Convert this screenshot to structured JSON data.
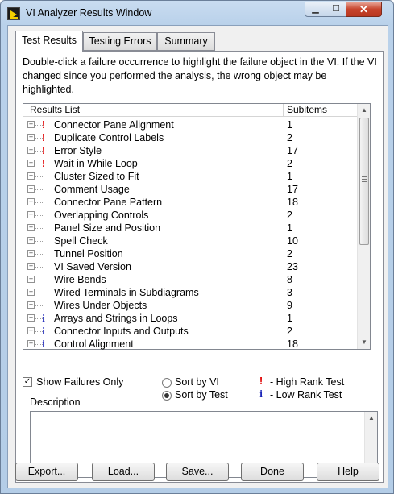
{
  "window": {
    "title": "VI Analyzer Results Window",
    "minimize_glyph": "▁",
    "maximize_glyph": "☐",
    "close_glyph": "✕"
  },
  "tabs": [
    {
      "label": "Test Results",
      "active": true
    },
    {
      "label": "Testing Errors",
      "active": false
    },
    {
      "label": "Summary",
      "active": false
    }
  ],
  "instructions": "Double-click a failure occurrence to highlight the failure object in the VI.  If the VI changed since you performed the analysis, the wrong object may be highlighted.",
  "results": {
    "col_name": "Results List",
    "col_count": "Subitems",
    "expand_glyph": "+",
    "scroll_up": "▲",
    "scroll_down": "▼",
    "rows": [
      {
        "mark": "!",
        "rank": "high",
        "name": "Connector Pane Alignment",
        "count": "1"
      },
      {
        "mark": "!",
        "rank": "high",
        "name": "Duplicate Control Labels",
        "count": "2"
      },
      {
        "mark": "!",
        "rank": "high",
        "name": "Error Style",
        "count": "17"
      },
      {
        "mark": "!",
        "rank": "high",
        "name": "Wait in While Loop",
        "count": "2"
      },
      {
        "mark": "",
        "rank": "none",
        "name": "Cluster Sized to Fit",
        "count": "1"
      },
      {
        "mark": "",
        "rank": "none",
        "name": "Comment Usage",
        "count": "17"
      },
      {
        "mark": "",
        "rank": "none",
        "name": "Connector Pane Pattern",
        "count": "18"
      },
      {
        "mark": "",
        "rank": "none",
        "name": "Overlapping Controls",
        "count": "2"
      },
      {
        "mark": "",
        "rank": "none",
        "name": "Panel Size and Position",
        "count": "1"
      },
      {
        "mark": "",
        "rank": "none",
        "name": "Spell Check",
        "count": "10"
      },
      {
        "mark": "",
        "rank": "none",
        "name": "Tunnel Position",
        "count": "2"
      },
      {
        "mark": "",
        "rank": "none",
        "name": "VI Saved Version",
        "count": "23"
      },
      {
        "mark": "",
        "rank": "none",
        "name": "Wire Bends",
        "count": "8"
      },
      {
        "mark": "",
        "rank": "none",
        "name": "Wired Terminals in Subdiagrams",
        "count": "3"
      },
      {
        "mark": "",
        "rank": "none",
        "name": "Wires Under Objects",
        "count": "9"
      },
      {
        "mark": "i",
        "rank": "low",
        "name": "Arrays and Strings in Loops",
        "count": "1"
      },
      {
        "mark": "i",
        "rank": "low",
        "name": "Connector Inputs and Outputs",
        "count": "2"
      },
      {
        "mark": "i",
        "rank": "low",
        "name": "Control Alignment",
        "count": "18"
      }
    ]
  },
  "options": {
    "show_failures_label": "Show Failures Only",
    "show_failures_checked": true,
    "check_glyph": "✓",
    "sort_by_vi_label": "Sort by VI",
    "sort_by_test_label": "Sort by Test",
    "sort_selected": "Sort by Test"
  },
  "legend": {
    "high_mark": "!",
    "high_label": "- High Rank Test",
    "low_mark": "i",
    "low_label": "- Low Rank Test"
  },
  "description": {
    "label": "Description",
    "text": ""
  },
  "buttons": {
    "export": "Export...",
    "load": "Load...",
    "save": "Save...",
    "done": "Done",
    "help": "Help"
  },
  "colors": {
    "high_rank": "#e00000",
    "low_rank": "#1b25b8"
  }
}
